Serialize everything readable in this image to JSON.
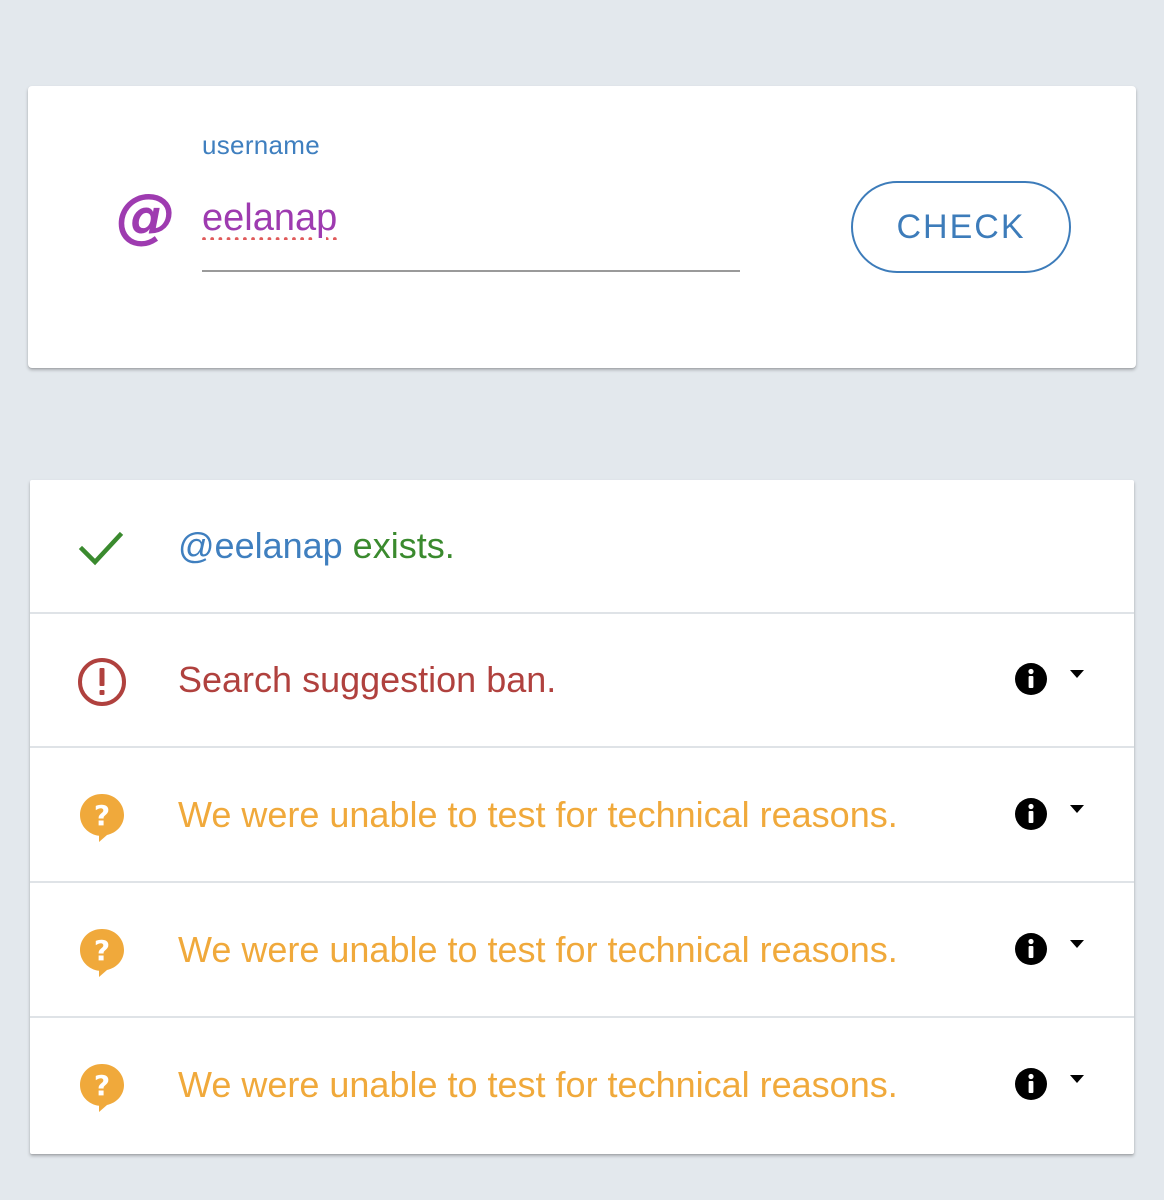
{
  "search": {
    "label": "username",
    "at_symbol": "@",
    "value": "eelanap",
    "button_label": "CHECK"
  },
  "results": [
    {
      "status": "ok",
      "icon": "check-icon",
      "handle": "@eelanap",
      "text": " exists.",
      "color": "#3a8a2e"
    },
    {
      "status": "ban",
      "icon": "alert-circle-icon",
      "text": "Search suggestion ban.",
      "color": "#b0413e",
      "has_info": true
    },
    {
      "status": "unknown",
      "icon": "help-bubble-icon",
      "text": "We were unable to test for technical reasons.",
      "color": "#f0a93b",
      "has_info": true
    },
    {
      "status": "unknown",
      "icon": "help-bubble-icon",
      "text": "We were unable to test for technical reasons.",
      "color": "#f0a93b",
      "has_info": true
    },
    {
      "status": "unknown",
      "icon": "help-bubble-icon",
      "text": "We were unable to test for technical reasons.",
      "color": "#f0a93b",
      "has_info": true
    }
  ],
  "colors": {
    "background": "#e3e8ed",
    "accent_blue": "#3d7cba",
    "purple": "#9e3bb0",
    "success": "#3a8a2e",
    "error": "#b0413e",
    "warning": "#f0a93b"
  }
}
